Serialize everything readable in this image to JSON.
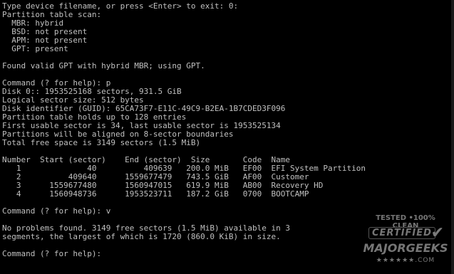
{
  "console": {
    "lines": [
      "Type device filename, or press <Enter> to exit: 0:",
      "Partition table scan:",
      "  MBR: hybrid",
      "  BSD: not present",
      "  APM: not present",
      "  GPT: present",
      "",
      "Found valid GPT with hybrid MBR; using GPT.",
      "",
      "Command (? for help): p",
      "Disk 0:: 1953525168 sectors, 931.5 GiB",
      "Logical sector size: 512 bytes",
      "Disk identifier (GUID): 65CA73F7-E11C-49C9-B2EA-1B7CDED3F096",
      "Partition table holds up to 128 entries",
      "First usable sector is 34, last usable sector is 1953525134",
      "Partitions will be aligned on 8-sector boundaries",
      "Total free space is 3149 sectors (1.5 MiB)",
      "",
      "Number  Start (sector)    End (sector)  Size       Code  Name",
      "   1              40          409639   200.0 MiB   EF00  EFI System Partition",
      "   2          409640      1559677479   743.5 GiB   AF00  Customer",
      "   3      1559677480      1560947015   619.9 MiB   AB00  Recovery HD",
      "   4      1560948736      1953523711   187.2 GiB   0700  BOOTCAMP",
      "",
      "Command (? for help): v",
      "",
      "No problems found. 3149 free sectors (1.5 MiB) available in 3",
      "segments, the largest of which is 1720 (860.0 KiB) in size.",
      "",
      "Command (? for help): "
    ]
  },
  "watermark": {
    "top": "TESTED •100% CLEAN",
    "certified": "CERTIFIED",
    "check": "✔",
    "brand": "MAJORGEEKS",
    "bottom": "★★★★★★.COM"
  }
}
